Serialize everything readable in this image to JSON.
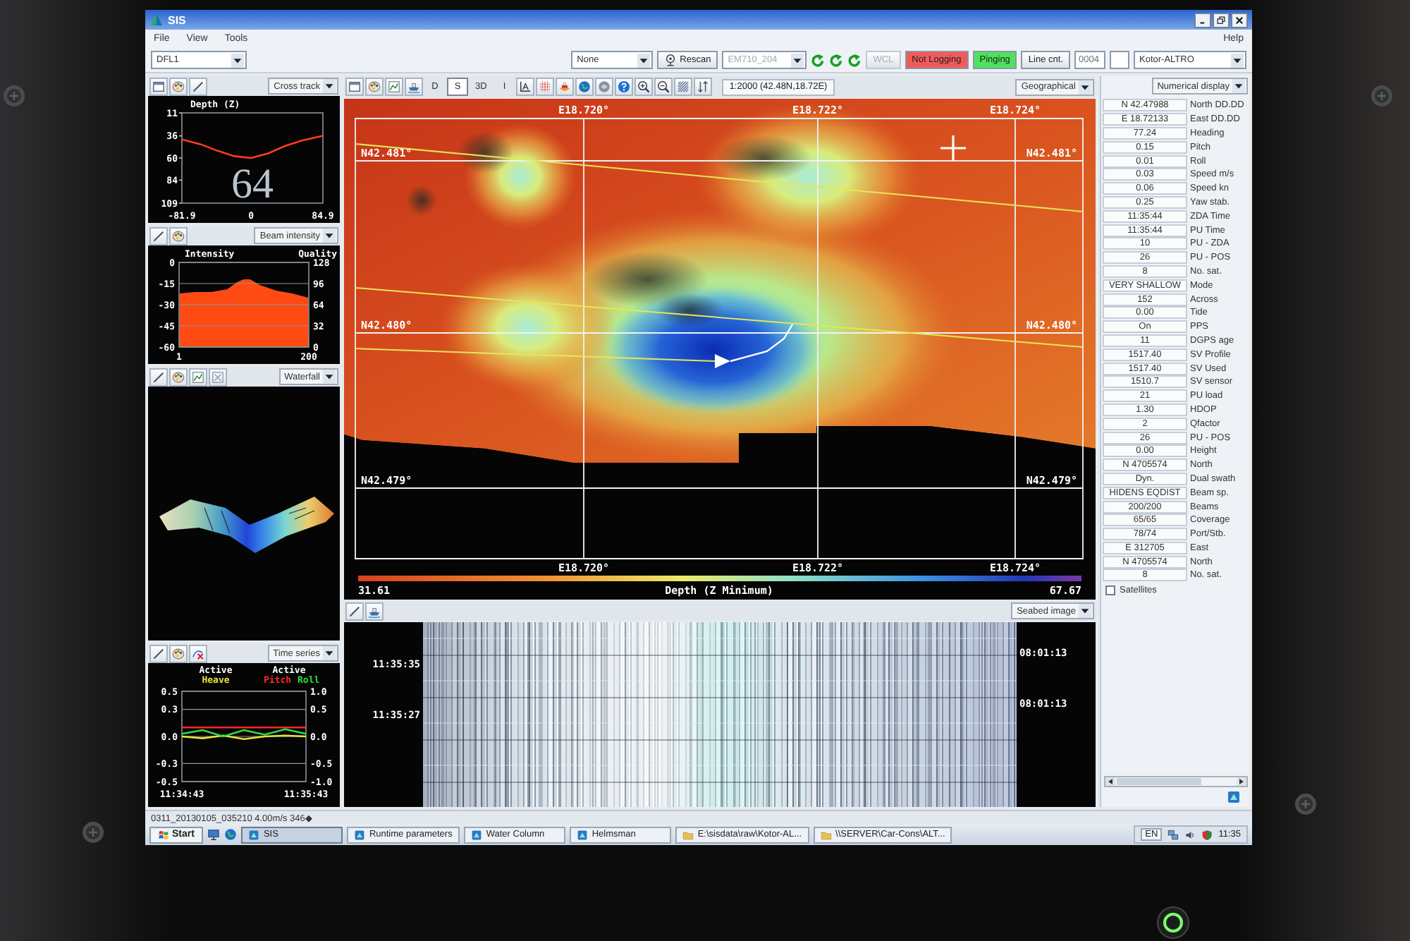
{
  "window": {
    "title": "SIS"
  },
  "menu": {
    "items": [
      "File",
      "View",
      "Tools"
    ],
    "help": "Help"
  },
  "toolbar": {
    "profile": "DFL1",
    "selector": "None",
    "rescan": "Rescan",
    "sounder": {
      "value": "EM710_204",
      "disabled": true
    },
    "wcl": {
      "label": "WCL",
      "disabled": true
    },
    "status_buttons": [
      {
        "label": "Not Logging",
        "color": "#f25a5a"
      },
      {
        "label": "Pinging",
        "color": "#4ee35a"
      }
    ],
    "line_counter": {
      "label": "Line cnt.",
      "value": "0004",
      "disabled": true
    },
    "project": "Kotor-ALTRO"
  },
  "left_panels": [
    {
      "kind": "cross_track",
      "view": "Cross track",
      "readout": "64",
      "chart_data": {
        "type": "line",
        "title": "Depth (Z)",
        "x": [
          -81.9,
          -60,
          -40,
          -20,
          0,
          20,
          40,
          60,
          84.9
        ],
        "series": [
          {
            "color": "#ff3c1e",
            "values": [
              40,
              45,
              52,
              58,
              60,
              55,
              47,
              41,
              36
            ]
          }
        ],
        "xlim": [
          -81.9,
          84.9
        ],
        "ylim": [
          109,
          11
        ],
        "xticks": [
          -81.9,
          0,
          84.9
        ],
        "yticks": [
          11,
          36,
          60,
          84,
          109
        ]
      }
    },
    {
      "kind": "beam_intensity",
      "view": "Beam intensity",
      "right_axis": {
        "title": "Quality",
        "ticks": [
          "128",
          "96",
          "64",
          "32",
          "0"
        ]
      },
      "chart_data": {
        "type": "area",
        "ylabel": "Intensity",
        "x": [
          1,
          2,
          25,
          50,
          75,
          90,
          100,
          110,
          125,
          150,
          175,
          199,
          200
        ],
        "series": [
          {
            "color": "#ff4a14",
            "values": [
              -60,
              -22,
              -21,
              -21,
              -19,
              -14,
              -12,
              -12,
              -16,
              -20,
              -22,
              -25,
              -60
            ]
          }
        ],
        "xlim": [
          1,
          200
        ],
        "ylim": [
          -60,
          0
        ],
        "xticks": [
          1,
          200
        ],
        "yticks": [
          0,
          -15,
          -30,
          -45,
          -60
        ],
        "grid": true
      }
    },
    {
      "kind": "waterfall",
      "view": "Waterfall"
    },
    {
      "kind": "time_series",
      "view": "Time series",
      "headers": [
        "Active",
        "Active"
      ],
      "right_axis": {
        "ticks": [
          "1.0",
          "0.5",
          "0.0",
          "-0.5",
          "-1.0"
        ]
      },
      "chart_data": {
        "type": "line",
        "categories": [
          "11:34:43",
          null,
          null,
          null,
          null,
          null,
          "11:35:43"
        ],
        "series": [
          {
            "name": "Heave",
            "color": "#e8e23c",
            "values": [
              0,
              -0.02,
              0.01,
              -0.03,
              0,
              0.01,
              0
            ]
          },
          {
            "name": "Pitch",
            "color": "#ff2626",
            "values": [
              0.1,
              0.1,
              0.1,
              0.1,
              0.1,
              0.1,
              0.1
            ]
          },
          {
            "name": "Roll",
            "color": "#2ee040",
            "values": [
              0.03,
              0.07,
              0,
              0.07,
              0.02,
              0.08,
              0.03
            ]
          }
        ],
        "ylim": [
          -0.5,
          0.5
        ],
        "yticks": [
          {
            "value": 0.5,
            "label": "0.5"
          },
          {
            "value": 0.3,
            "label": "0.3"
          },
          {
            "value": 0,
            "label": "0.0"
          },
          {
            "value": -0.3,
            "label": "-0.3"
          },
          {
            "value": -0.5,
            "label": "-0.5"
          }
        ],
        "grid": true
      }
    }
  ],
  "map": {
    "view_modes": [
      {
        "label": "D",
        "selected": false
      },
      {
        "label": "S",
        "selected": true
      },
      {
        "label": "3D",
        "selected": false
      },
      {
        "label": "I",
        "selected": false
      }
    ],
    "scale": "1:2000 (42.48N,18.72E)",
    "view": "Geographical",
    "top_labels": [
      "E18.720°",
      "E18.722°",
      "E18.724°"
    ],
    "bottom_labels": [
      "E18.720°",
      "E18.722°",
      "E18.724°"
    ],
    "left_labels": [
      "N42.481°",
      "N42.480°",
      "N42.479°"
    ],
    "right_labels": [
      "N42.481°",
      "N42.480°",
      "N42.479°"
    ],
    "color_scale": {
      "min": "31.61",
      "title": "Depth (Z Minimum)",
      "max": "67.67"
    }
  },
  "seabed": {
    "view": "Seabed image",
    "left_times": [
      "11:35:35",
      "11:35:27"
    ],
    "right_times": [
      "08:01:13",
      "08:01:13"
    ]
  },
  "numerical": {
    "view": "Numerical display",
    "rows": [
      {
        "value": "N 42.47988",
        "label": "North DD.DD"
      },
      {
        "value": "E 18.72133",
        "label": "East DD.DD"
      },
      {
        "value": "77.24",
        "label": "Heading"
      },
      {
        "value": "0.15",
        "label": "Pitch"
      },
      {
        "value": "0.01",
        "label": "Roll"
      },
      {
        "value": "0.03",
        "label": "Speed m/s"
      },
      {
        "value": "0.06",
        "label": "Speed kn"
      },
      {
        "value": "0.25",
        "label": "Yaw stab."
      },
      {
        "value": "11:35:44",
        "label": "ZDA Time"
      },
      {
        "value": "11:35:44",
        "label": "PU Time"
      },
      {
        "value": "10",
        "label": "PU - ZDA"
      },
      {
        "value": "26",
        "label": "PU - POS"
      },
      {
        "value": "8",
        "label": "No. sat."
      },
      {
        "value": "VERY SHALLOW",
        "label": "Mode"
      },
      {
        "value": "152",
        "label": "Across"
      },
      {
        "value": "0.00",
        "label": "Tide"
      },
      {
        "value": "On",
        "label": "PPS"
      },
      {
        "value": "11",
        "label": "DGPS age"
      },
      {
        "value": "1517.40",
        "label": "SV Profile"
      },
      {
        "value": "1517.40",
        "label": "SV Used"
      },
      {
        "value": "1510.7",
        "label": "SV sensor"
      },
      {
        "value": "21",
        "label": "PU load"
      },
      {
        "value": "1.30",
        "label": "HDOP"
      },
      {
        "value": "2",
        "label": "Qfactor"
      },
      {
        "value": "26",
        "label": "PU - POS"
      },
      {
        "value": "0.00",
        "label": "Height"
      },
      {
        "value": "N 4705574",
        "label": "North"
      },
      {
        "value": "Dyn.",
        "label": "Dual swath"
      },
      {
        "value": "HIDENS EQDIST",
        "label": "Beam sp."
      },
      {
        "value": "200/200",
        "label": "Beams"
      },
      {
        "value": "65/65",
        "label": "Coverage"
      },
      {
        "value": "78/74",
        "label": "Port/Stb."
      },
      {
        "value": "E 312705",
        "label": "East"
      },
      {
        "value": "N 4705574",
        "label": "North"
      },
      {
        "value": "8",
        "label": "No. sat."
      }
    ],
    "satellites": {
      "label": "Satellites",
      "checked": false
    }
  },
  "status_bar": "0311_20130105_035210 4.00m/s 346◆",
  "taskbar": {
    "start": "Start",
    "tasks": [
      {
        "kind": "app",
        "label": "SIS",
        "selected": true
      },
      {
        "kind": "app",
        "label": "Runtime parameters",
        "selected": false
      },
      {
        "kind": "app",
        "label": "Water Column",
        "selected": false
      },
      {
        "kind": "app",
        "label": "Helmsman",
        "selected": false
      },
      {
        "kind": "folder",
        "label": "E:\\sisdata\\raw\\Kotor-AL...",
        "selected": false
      },
      {
        "kind": "folder",
        "label": "\\\\SERVER\\Car-Cons\\ALT...",
        "selected": false
      }
    ],
    "language": "EN",
    "clock": "11:35"
  }
}
